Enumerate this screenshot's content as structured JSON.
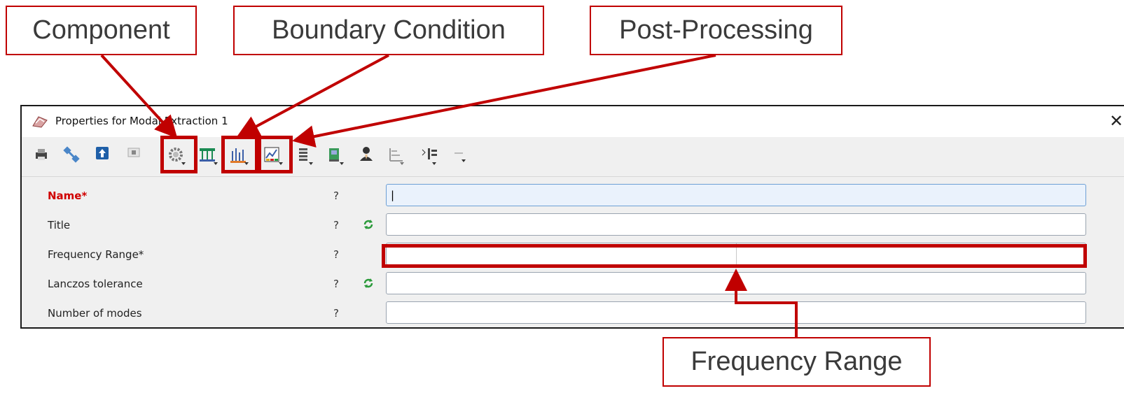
{
  "callouts": {
    "component": "Component",
    "boundary_condition": "Boundary Condition",
    "post_processing": "Post-Processing",
    "frequency_range": "Frequency Range"
  },
  "dialog": {
    "title": "Properties for Modal Extraction  1",
    "close_glyph": "✕"
  },
  "toolbar": {
    "items": [
      {
        "icon": "print-icon"
      },
      {
        "icon": "satellite-icon"
      },
      {
        "icon": "upload-icon"
      },
      {
        "icon": "id-icon"
      },
      {
        "icon": "gear-icon",
        "highlighted": true
      },
      {
        "icon": "beam-icon"
      },
      {
        "icon": "bar-chart-icon",
        "highlighted": true
      },
      {
        "icon": "line-chart-icon",
        "highlighted": true
      },
      {
        "icon": "stack-icon"
      },
      {
        "icon": "export-icon"
      },
      {
        "icon": "user-icon"
      },
      {
        "icon": "axes-icon"
      },
      {
        "icon": "align-icon"
      },
      {
        "icon": "more-icon"
      }
    ]
  },
  "form": {
    "rows": [
      {
        "label": "Name*",
        "help": "?",
        "value": "|",
        "required": true
      },
      {
        "label": "Title",
        "help": "?",
        "value": ""
      },
      {
        "label": "Frequency Range*",
        "help": "?",
        "value": ""
      },
      {
        "label": "Lanczos tolerance",
        "help": "?",
        "value": ""
      },
      {
        "label": "Number of modes",
        "help": "?",
        "value": ""
      }
    ]
  },
  "colors": {
    "annotation_red": "#c00000",
    "required_label": "#d00000",
    "focus_blue": "#eaf2fc"
  }
}
